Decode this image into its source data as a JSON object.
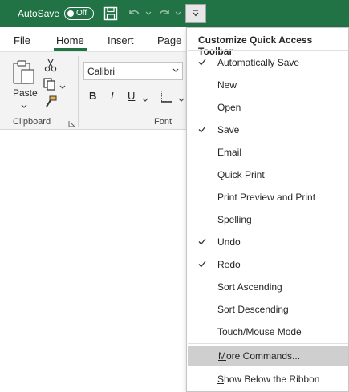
{
  "titlebar": {
    "autosave_label": "AutoSave",
    "autosave_state": "Off",
    "accent_color": "#217346"
  },
  "ribbon": {
    "tabs": [
      {
        "label": "File"
      },
      {
        "label": "Home"
      },
      {
        "label": "Insert"
      },
      {
        "label": "Page"
      }
    ],
    "paste_label": "Paste",
    "font_name": "Calibri",
    "bold_label": "B",
    "italic_label": "I",
    "underline_label": "U",
    "clipboard_group": "Clipboard",
    "font_group": "Font"
  },
  "menu": {
    "title": "Customize Quick Access Toolbar",
    "items": [
      {
        "label": "Automatically Save",
        "checked": true
      },
      {
        "label": "New",
        "checked": false
      },
      {
        "label": "Open",
        "checked": false
      },
      {
        "label": "Save",
        "checked": true
      },
      {
        "label": "Email",
        "checked": false
      },
      {
        "label": "Quick Print",
        "checked": false
      },
      {
        "label": "Print Preview and Print",
        "checked": false
      },
      {
        "label": "Spelling",
        "checked": false
      },
      {
        "label": "Undo",
        "checked": true
      },
      {
        "label": "Redo",
        "checked": true
      },
      {
        "label": "Sort Ascending",
        "checked": false
      },
      {
        "label": "Sort Descending",
        "checked": false
      },
      {
        "label": "Touch/Mouse Mode",
        "checked": false
      }
    ],
    "more_commands_prefix": "M",
    "more_commands_rest": "ore Commands...",
    "show_below_prefix": "S",
    "show_below_rest": "how Below the Ribbon"
  }
}
